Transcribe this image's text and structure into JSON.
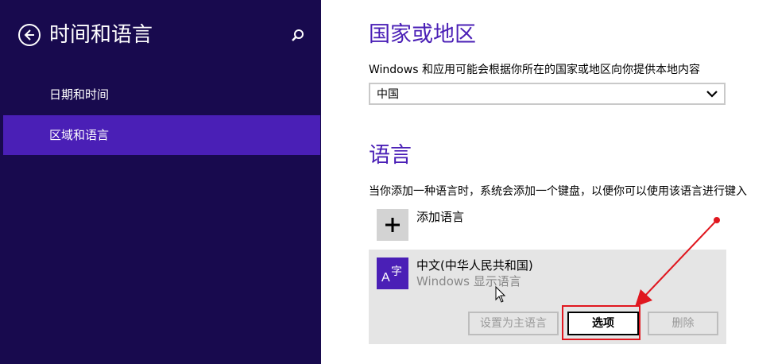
{
  "sidebar": {
    "title": "时间和语言",
    "items": [
      {
        "label": "日期和时间",
        "selected": false
      },
      {
        "label": "区域和语言",
        "selected": true
      }
    ]
  },
  "region": {
    "heading": "国家或地区",
    "description": "Windows 和应用可能会根据你所在的国家或地区向你提供本地内容",
    "selected_value": "中国"
  },
  "language": {
    "heading": "语言",
    "description": "当你添加一种语言时，系统会添加一个键盘，以便你可以使用该语言进行键入",
    "add_label": "添加语言",
    "items": [
      {
        "name": "中文(中华人民共和国)",
        "subtitle": "Windows 显示语言",
        "icon_text": "A字"
      }
    ],
    "buttons": {
      "set_primary": "设置为主语言",
      "options": "选项",
      "remove": "删除"
    }
  },
  "colors": {
    "sidebar_bg": "#180a4e",
    "accent": "#4a1fb6",
    "annotation_red": "#e0171f"
  }
}
